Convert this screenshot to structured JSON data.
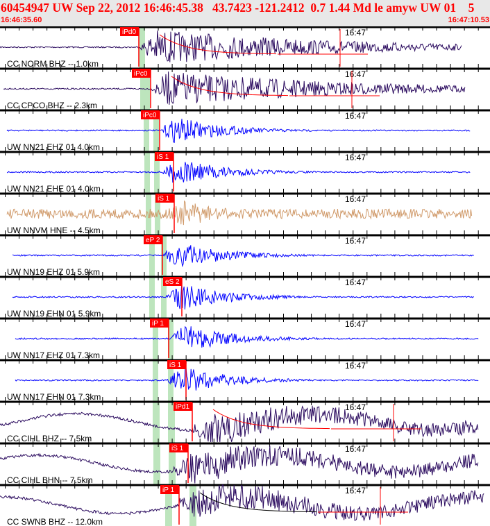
{
  "header": {
    "title": "60454947 UW Sep 22, 2012 16:46:45.38   43.7423 -121.2412  0.7 1.44 Md le amyw UW 01    5",
    "start_time": "16:46:35.60",
    "end_time": "16:47:10.53"
  },
  "minute_label": "16:47",
  "colors": {
    "header_text": "#ff0000",
    "pick": "#ff0000",
    "window": "#bde5bd",
    "cc_trace": "#2a0a5e",
    "uw_trace": "#0000ff",
    "hne_trace": "#d09a6a"
  },
  "traces": [
    {
      "label": "CC NORM BHZ -- 1.0km",
      "pick": "iPd0",
      "color": "#2a0a5e"
    },
    {
      "label": "CC CPCO BHZ -- 2.3km",
      "pick": "iPc0",
      "color": "#2a0a5e"
    },
    {
      "label": "UW NN21 EHZ 01 4.0km",
      "pick": "iPc0",
      "color": "#0000ff"
    },
    {
      "label": "UW NN21 EHE 01 4.0km",
      "pick": "iS 1",
      "color": "#0000ff"
    },
    {
      "label": "UW NNVM HNE -- 4.5km",
      "pick": "iS 1",
      "color": "#d09a6a"
    },
    {
      "label": "UW NN19 EHZ 01 5.9km",
      "pick": "eP 2",
      "color": "#0000ff"
    },
    {
      "label": "UW NN19 EHN 01 5.9km",
      "pick": "eS 2",
      "color": "#0000ff"
    },
    {
      "label": "UW NN17 EHZ 01 7.3km",
      "pick": "iP 1",
      "color": "#0000ff"
    },
    {
      "label": "UW NN17 EHN 01 7.3km",
      "pick": "iS 1",
      "color": "#0000ff"
    },
    {
      "label": "CC CIHL BHZ -- 7.5km",
      "pick": "iPd1",
      "color": "#2a0a5e"
    },
    {
      "label": "CC CIHL BHN -- 7.5km",
      "pick": "iS 1",
      "color": "#2a0a5e"
    },
    {
      "label": "CC SWNB BHZ -- 12.0km",
      "pick": "iP 1",
      "color": "#2a0a5e"
    }
  ]
}
